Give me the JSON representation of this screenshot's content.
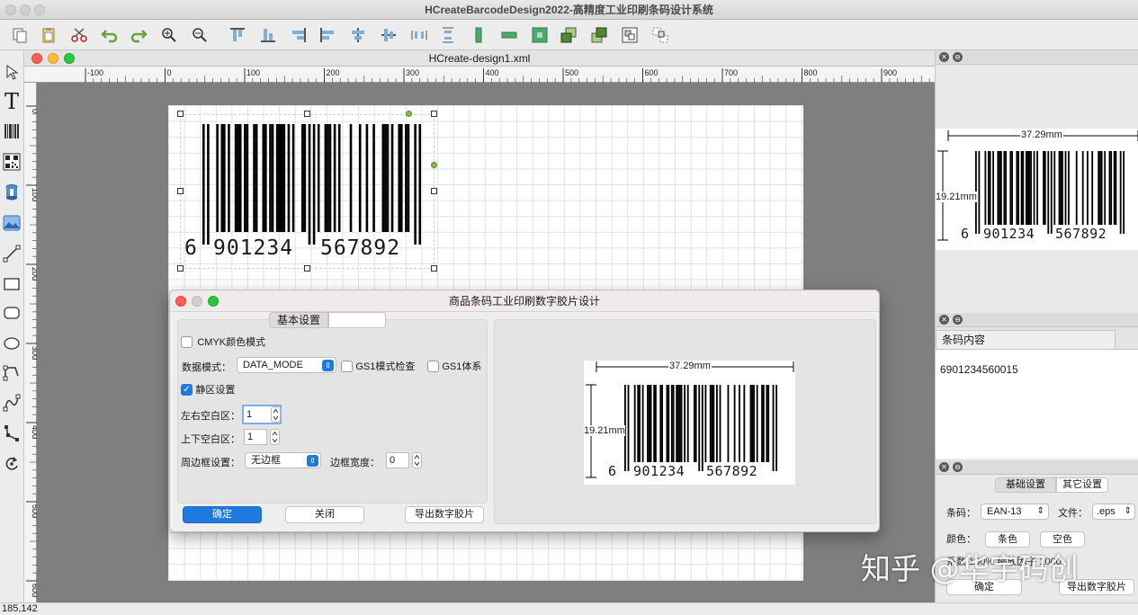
{
  "app": {
    "title": "HCreateBarcodeDesign2022-高精度工业印刷条码设计系统"
  },
  "toolbar": {
    "buttons": [
      "copy-icon",
      "paste-icon",
      "cut-icon",
      "undo-icon",
      "redo-icon",
      "zoom-in-icon",
      "zoom-out-icon",
      "align-top-icon",
      "align-bottom-icon",
      "align-right-icon",
      "align-left-icon",
      "center-h-icon",
      "center-v-icon",
      "distribute-h-icon",
      "distribute-v-icon",
      "same-width-icon",
      "same-height-icon",
      "same-size-icon",
      "bring-front-icon",
      "send-back-icon",
      "group-icon",
      "ungroup-icon"
    ]
  },
  "lefttools": [
    "pointer-icon",
    "text-tool-icon",
    "barcode-tool-icon",
    "qrcode-tool-icon",
    "database-tool-icon",
    "image-tool-icon",
    "line-tool-icon",
    "rect-tool-icon",
    "rounded-rect-tool-icon",
    "ellipse-tool-icon",
    "polyline-tool-icon",
    "curve-tool-icon",
    "path-tool-icon",
    "rotate-tool-icon"
  ],
  "document": {
    "title": "HCreate-design1.xml",
    "ruler_h": [
      "-100",
      "0",
      "100",
      "200",
      "300",
      "400",
      "500",
      "600",
      "700",
      "800",
      "900"
    ],
    "ruler_v": [
      "0",
      "100",
      "200",
      "300",
      "400",
      "500",
      "600"
    ],
    "barcode": {
      "digit_first": "6",
      "group_left": "901234",
      "group_right": "567892"
    }
  },
  "dialog": {
    "title": "商品条码工业印刷数字胶片设计",
    "tab_label": "基本设置",
    "cmyk_label": "CMYK颜色模式",
    "data_mode_label": "数据模式：",
    "data_mode_value": "DATA_MODE",
    "gs1_check_label": "GS1模式检查",
    "gs1_system_label": "GS1体系",
    "quiet_zone_label": "静区设置",
    "lr_margin_label": "左右空白区：",
    "lr_margin_value": "1",
    "tb_margin_label": "上下空白区：",
    "tb_margin_value": "1",
    "border_label": "周边框设置：",
    "border_value": "无边框",
    "border_width_label": "边框宽度：",
    "border_width_value": "0",
    "ok_button": "确定",
    "close_button": "关闭",
    "export_button": "导出数字胶片",
    "preview": {
      "width_label": "37.29mm",
      "height_label": "19.21mm",
      "digit_first": "6",
      "group_left": "901234",
      "group_right": "567892"
    }
  },
  "right_top": {
    "preview": {
      "width_label": "37.29mm",
      "height_label": "19.21mm",
      "digit_first": "6",
      "group_left": "901234",
      "group_right": "567892"
    }
  },
  "right_mid": {
    "tab_label": "条码内容",
    "content": "6901234560015"
  },
  "right_bottom": {
    "tab_basic": "基础设置",
    "tab_other": "其它设置",
    "barcode_label": "条码：",
    "barcode_value": "EAN-13",
    "file_label": "文件：",
    "file_value": ".eps",
    "color_label": "颜色：",
    "bar_color_button": "条色",
    "space_color_button": "空色",
    "partial_row": "系数  100%  缩放因子  1000",
    "ok_button": "确定",
    "export_button": "导出数字胶片"
  },
  "watermark": {
    "text": "知乎 @华宇码创"
  },
  "status": {
    "coords": "185,142"
  }
}
